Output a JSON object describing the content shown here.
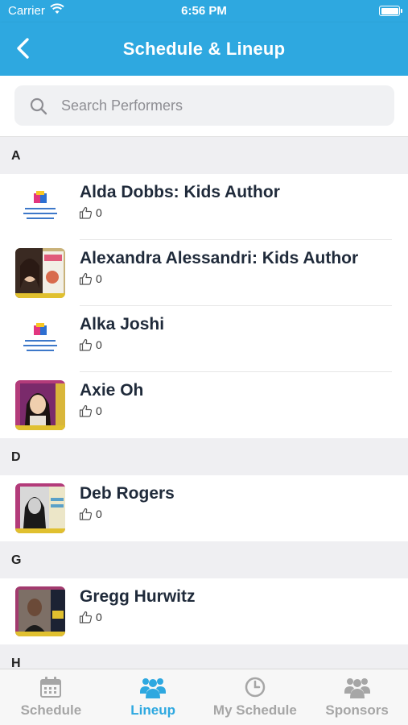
{
  "status_bar": {
    "carrier": "Carrier",
    "time": "6:56 PM"
  },
  "nav": {
    "title": "Schedule & Lineup"
  },
  "search": {
    "placeholder": "Search Performers"
  },
  "sections": [
    {
      "letter": "A",
      "performers": [
        {
          "name": "Alda Dobbs: Kids Author",
          "likes": "0",
          "avatar": "festival-logo"
        },
        {
          "name": "Alexandra Alessandri: Kids Author",
          "likes": "0",
          "avatar": "photo"
        },
        {
          "name": "Alka Joshi",
          "likes": "0",
          "avatar": "festival-logo"
        },
        {
          "name": "Axie Oh",
          "likes": "0",
          "avatar": "photo"
        }
      ]
    },
    {
      "letter": "D",
      "performers": [
        {
          "name": "Deb Rogers",
          "likes": "0",
          "avatar": "photo"
        }
      ]
    },
    {
      "letter": "G",
      "performers": [
        {
          "name": "Gregg Hurwitz",
          "likes": "0",
          "avatar": "photo"
        }
      ]
    },
    {
      "letter": "H",
      "performers": []
    }
  ],
  "tabs": [
    {
      "label": "Schedule",
      "icon": "calendar-icon",
      "active": false
    },
    {
      "label": "Lineup",
      "icon": "group-icon",
      "active": true
    },
    {
      "label": "My Schedule",
      "icon": "clock-icon",
      "active": false
    },
    {
      "label": "Sponsors",
      "icon": "group-icon",
      "active": false
    }
  ],
  "colors": {
    "accent": "#2ea8e0",
    "inactive": "#a6a6a6",
    "section_bg": "#efeff2"
  }
}
